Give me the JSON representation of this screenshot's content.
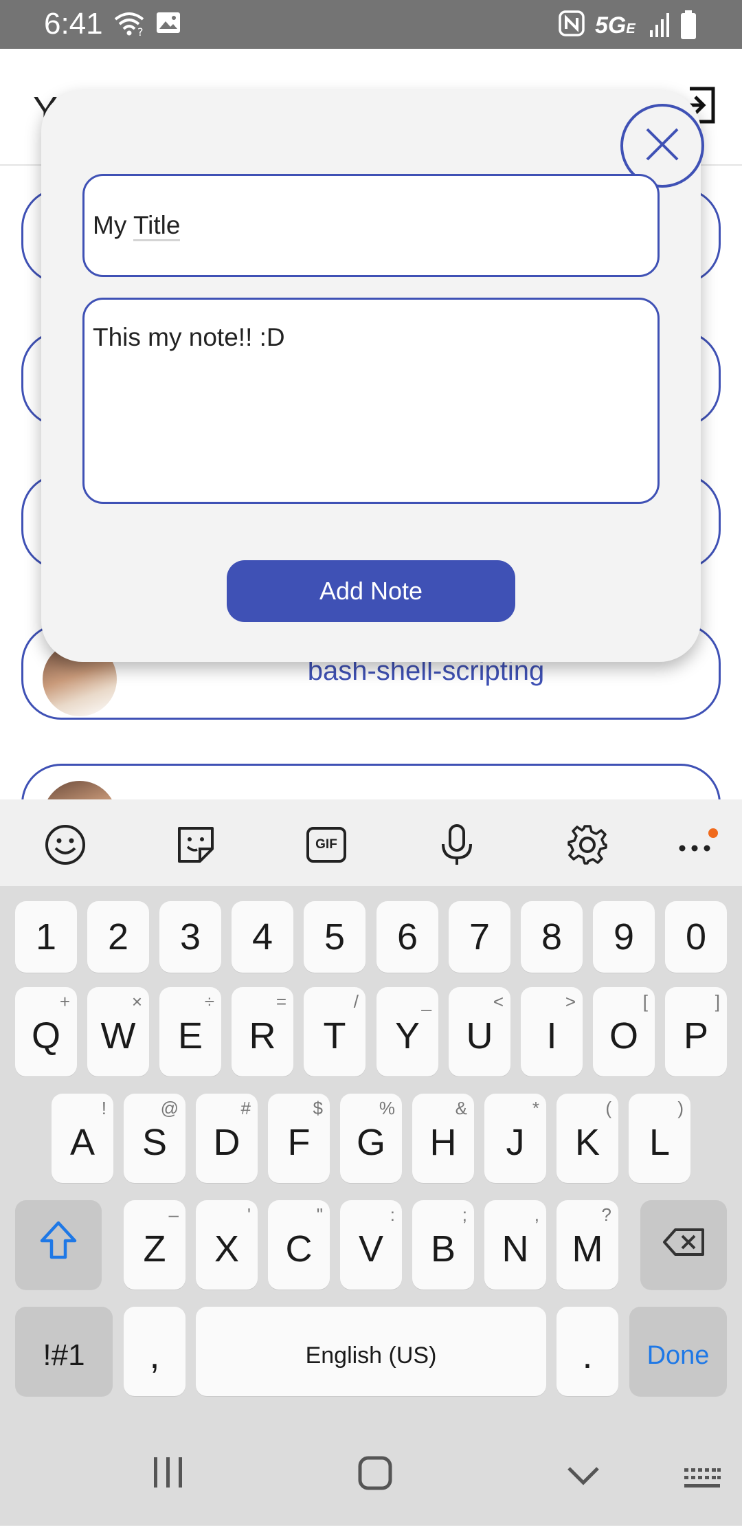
{
  "status_bar": {
    "time": "6:41",
    "network": "5G",
    "network_sub": "E",
    "icons": [
      "wifi-question-icon",
      "image-icon",
      "nfc-icon",
      "signal-icon",
      "battery-icon"
    ]
  },
  "header": {
    "title_partial": "Y",
    "action_icon": "logout-icon"
  },
  "list": {
    "items": [
      {
        "title": ""
      },
      {
        "title": ""
      },
      {
        "title": ""
      },
      {
        "title": "bash-shell-scripting"
      },
      {
        "title": ""
      }
    ]
  },
  "modal": {
    "title_value": "My Title",
    "title_prefix": "My ",
    "title_underlined": "Title",
    "body_value": "This my note!! :D",
    "submit_label": "Add Note",
    "close_icon": "close-circle-icon"
  },
  "keyboard": {
    "toolbar_icons": [
      "emoji-icon",
      "sticker-icon",
      "gif-icon",
      "microphone-icon",
      "settings-icon",
      "more-icon"
    ],
    "gif_label": "GIF",
    "number_row": [
      "1",
      "2",
      "3",
      "4",
      "5",
      "6",
      "7",
      "8",
      "9",
      "0"
    ],
    "row1": [
      {
        "key": "Q",
        "hint": "+"
      },
      {
        "key": "W",
        "hint": "×"
      },
      {
        "key": "E",
        "hint": "÷"
      },
      {
        "key": "R",
        "hint": "="
      },
      {
        "key": "T",
        "hint": "/"
      },
      {
        "key": "Y",
        "hint": "_"
      },
      {
        "key": "U",
        "hint": "<"
      },
      {
        "key": "I",
        "hint": ">"
      },
      {
        "key": "O",
        "hint": "["
      },
      {
        "key": "P",
        "hint": "]"
      }
    ],
    "row2": [
      {
        "key": "A",
        "hint": "!"
      },
      {
        "key": "S",
        "hint": "@"
      },
      {
        "key": "D",
        "hint": "#"
      },
      {
        "key": "F",
        "hint": "$"
      },
      {
        "key": "G",
        "hint": "%"
      },
      {
        "key": "H",
        "hint": "&"
      },
      {
        "key": "J",
        "hint": "*"
      },
      {
        "key": "K",
        "hint": "("
      },
      {
        "key": "L",
        "hint": ")"
      }
    ],
    "row3": [
      {
        "key": "Z",
        "hint": "–"
      },
      {
        "key": "X",
        "hint": "'"
      },
      {
        "key": "C",
        "hint": "\""
      },
      {
        "key": "V",
        "hint": ":"
      },
      {
        "key": "B",
        "hint": ";"
      },
      {
        "key": "N",
        "hint": ","
      },
      {
        "key": "M",
        "hint": "?"
      }
    ],
    "symbols_label": "!#1",
    "comma_label": ",",
    "space_label": "English (US)",
    "period_label": ".",
    "done_label": "Done",
    "accent_color": "#1e78e6"
  },
  "nav_bar": {
    "icons": [
      "recents-icon",
      "home-icon",
      "back-chevron-icon",
      "keyboard-switch-icon"
    ]
  },
  "colors": {
    "primary": "#3f51b5",
    "status_bar": "#747474",
    "notification_dot": "#f06a1c"
  }
}
